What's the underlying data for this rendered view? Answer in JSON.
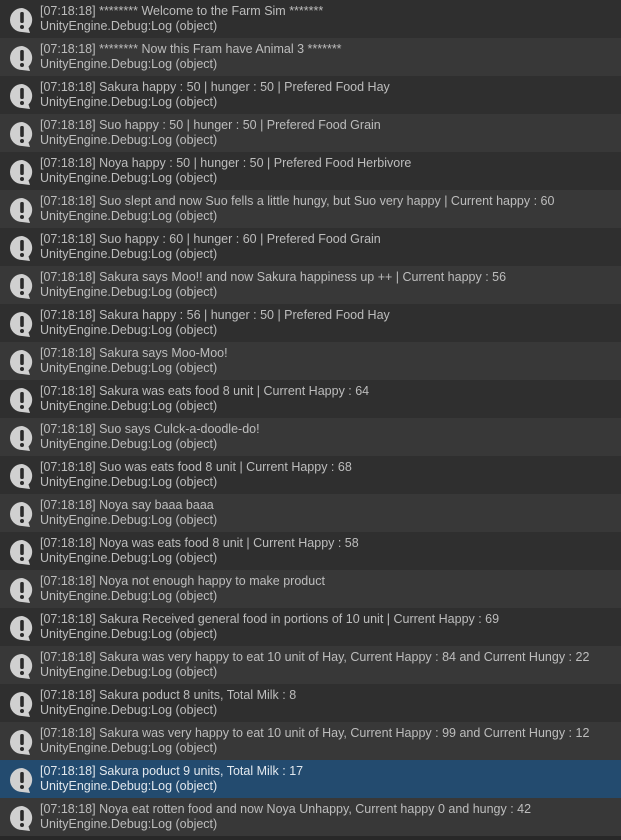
{
  "console": {
    "icon": "warning-speech-bubble-icon",
    "selected_index": 20,
    "colors": {
      "row_even": "#2f2f2f",
      "row_odd": "#383838",
      "selected": "#234b6f",
      "text": "#bdbdbd"
    },
    "entries": [
      {
        "message": "[07:18:18]  ******** Welcome to the Farm Sim *******",
        "source": "UnityEngine.Debug:Log (object)"
      },
      {
        "message": "[07:18:18]  ******** Now this Fram have Animal 3 *******",
        "source": "UnityEngine.Debug:Log (object)"
      },
      {
        "message": "[07:18:18] Sakura happy : 50 | hunger : 50 | Prefered Food Hay",
        "source": "UnityEngine.Debug:Log (object)"
      },
      {
        "message": "[07:18:18] Suo happy : 50 | hunger : 50 | Prefered Food Grain",
        "source": "UnityEngine.Debug:Log (object)"
      },
      {
        "message": "[07:18:18] Noya happy : 50 | hunger : 50 | Prefered Food Herbivore",
        "source": "UnityEngine.Debug:Log (object)"
      },
      {
        "message": "[07:18:18] Suo slept and now Suo fells a little hungy, but Suo very happy | Current happy : 60",
        "source": "UnityEngine.Debug:Log (object)"
      },
      {
        "message": "[07:18:18] Suo happy : 60 | hunger : 60 | Prefered Food Grain",
        "source": "UnityEngine.Debug:Log (object)"
      },
      {
        "message": "[07:18:18] Sakura says Moo!! and now Sakura happiness up ++ | Current happy : 56",
        "source": "UnityEngine.Debug:Log (object)"
      },
      {
        "message": "[07:18:18] Sakura happy : 56 | hunger : 50 | Prefered Food Hay",
        "source": "UnityEngine.Debug:Log (object)"
      },
      {
        "message": "[07:18:18] Sakura says Moo-Moo!",
        "source": "UnityEngine.Debug:Log (object)"
      },
      {
        "message": "[07:18:18] Sakura was eats food 8 unit | Current Happy : 64",
        "source": "UnityEngine.Debug:Log (object)"
      },
      {
        "message": "[07:18:18] Suo says Culck-a-doodle-do!",
        "source": "UnityEngine.Debug:Log (object)"
      },
      {
        "message": "[07:18:18] Suo was eats food 8 unit | Current Happy : 68",
        "source": "UnityEngine.Debug:Log (object)"
      },
      {
        "message": "[07:18:18]  Noya say baaa baaa",
        "source": "UnityEngine.Debug:Log (object)"
      },
      {
        "message": "[07:18:18] Noya was eats food 8 unit | Current Happy : 58",
        "source": "UnityEngine.Debug:Log (object)"
      },
      {
        "message": "[07:18:18] Noya not enough happy to make product",
        "source": "UnityEngine.Debug:Log (object)"
      },
      {
        "message": "[07:18:18] Sakura Received general food in portions of 10 unit | Current Happy : 69",
        "source": "UnityEngine.Debug:Log (object)"
      },
      {
        "message": "[07:18:18] Sakura was very happy to eat 10 unit of Hay, Current Happy : 84 and Current Hungy : 22",
        "source": "UnityEngine.Debug:Log (object)"
      },
      {
        "message": "[07:18:18] Sakura poduct 8 units, Total Milk : 8",
        "source": "UnityEngine.Debug:Log (object)"
      },
      {
        "message": "[07:18:18] Sakura was very happy to eat 10 unit of Hay, Current Happy : 99 and Current Hungy : 12",
        "source": "UnityEngine.Debug:Log (object)"
      },
      {
        "message": "[07:18:18] Sakura poduct 9 units, Total Milk : 17",
        "source": "UnityEngine.Debug:Log (object)"
      },
      {
        "message": "[07:18:18] Noya eat rotten food and now Noya Unhappy, Current happy 0 and hungy : 42",
        "source": "UnityEngine.Debug:Log (object)"
      }
    ]
  }
}
